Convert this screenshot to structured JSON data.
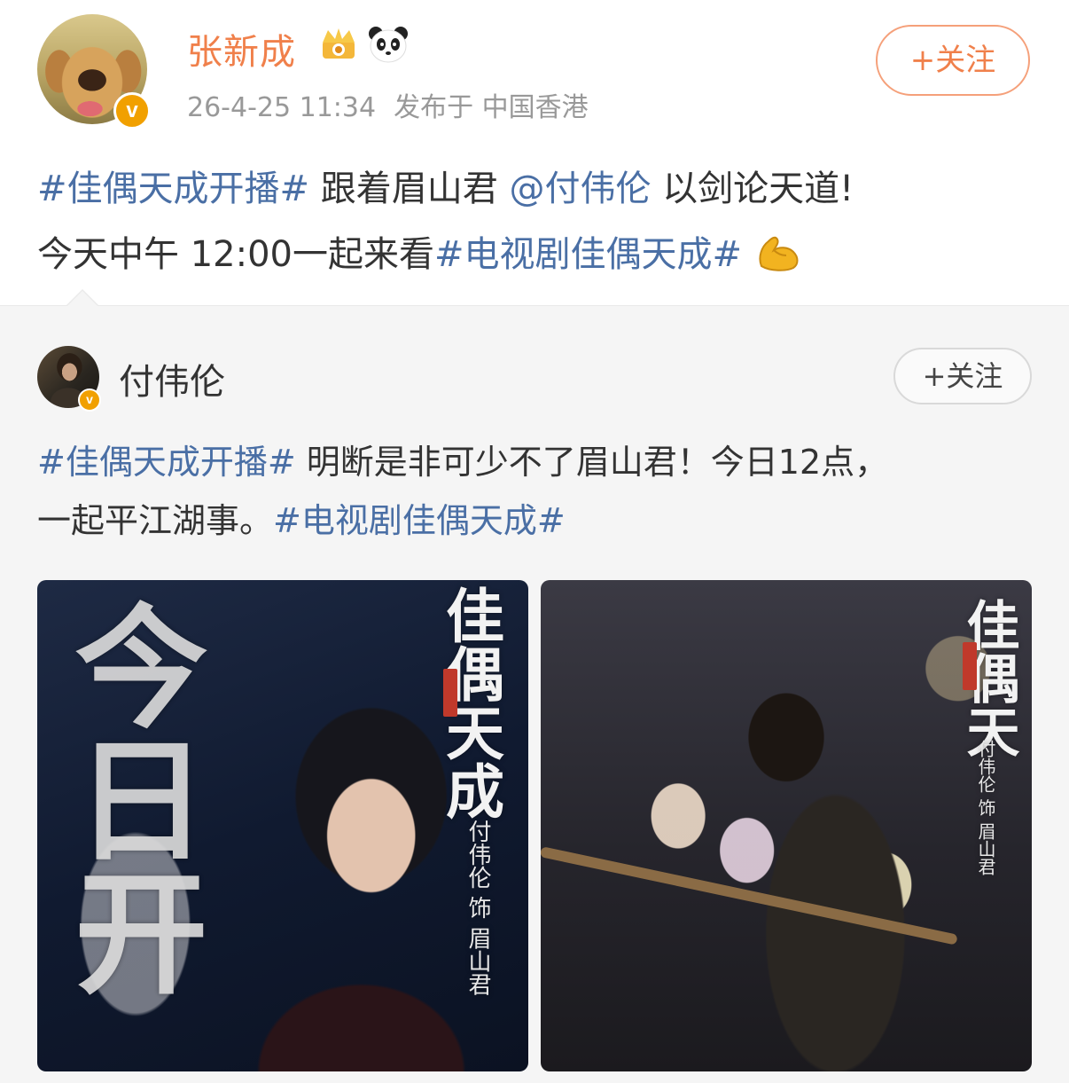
{
  "post": {
    "username": "张新成",
    "timestamp": "26-4-25 11:34",
    "location": "发布于 中国香港",
    "follow_label": "+关注",
    "text": {
      "topic1": "#佳偶天成开播#",
      "part1": " 跟着眉山君 ",
      "mention": "@付伟伦",
      "part2": " 以剑论天道!",
      "part3": "今天中午 12:00一起来看",
      "topic2": "#电视剧佳偶天成#"
    },
    "icons": [
      "verified-badge",
      "crown-badge",
      "panda-icon",
      "flexed-biceps-emoji"
    ]
  },
  "repost": {
    "username": "付伟伦",
    "follow_label": "+关注",
    "text": {
      "topic1": "#佳偶天成开播#",
      "part1": " 明断是非可少不了眉山君！今日12点，",
      "part2": "一起平江湖事。",
      "topic2": "#电视剧佳偶天成#"
    },
    "images": [
      {
        "big": "今日开",
        "title": "佳偶天成",
        "credit": "付伟伦 饰 眉山君"
      },
      {
        "title": "佳偶天",
        "credit": "付伟伦 饰 眉山君"
      }
    ]
  },
  "colors": {
    "username": "#f0804b",
    "topic": "#4a6fa5",
    "meta": "#999999",
    "repost_bg": "#f5f5f5"
  }
}
